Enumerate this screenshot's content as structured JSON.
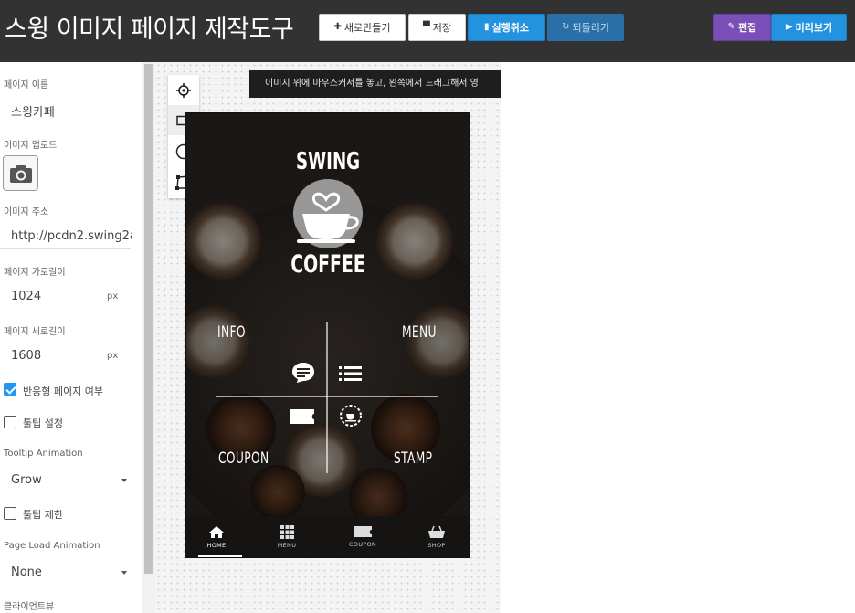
{
  "header": {
    "title": "스윙 이미지 페이지 제작도구",
    "buttons": {
      "new_label": "새로만들기",
      "save_label": "저장",
      "undo_label": "실행취소",
      "redo_label": "되돌리기",
      "edit_label": "편집",
      "preview_label": "미리보기"
    }
  },
  "sidebar": {
    "page_name_label": "페이지 이름",
    "page_name_value": "스윙카페",
    "image_upload_label": "이미지 업로드",
    "image_url_label": "이미지 주소",
    "image_url_value": "http://pcdn2.swing2a",
    "page_width_label": "페이지 가로길이",
    "page_width_value": "1024",
    "page_height_label": "페이지 세로길이",
    "page_height_value": "1608",
    "unit": "px",
    "responsive_label": "반응형 페이지 여부",
    "responsive_checked": true,
    "tooltip_setting_label": "툴팁 설정",
    "tooltip_setting_checked": false,
    "tooltip_animation_label": "Tooltip Animation",
    "tooltip_animation_value": "Grow",
    "tooltip_limit_label": "툴팁 제한",
    "tooltip_limit_checked": false,
    "page_load_animation_label": "Page Load Animation",
    "page_load_animation_value": "None",
    "client_view_label": "클라이언트뷰"
  },
  "canvas": {
    "hint_text": "이미지 위에 마우스커서를 놓고, 왼쪽에서 드래그해서 영",
    "tools": [
      "crosshair-icon",
      "rectangle-icon",
      "circle-icon",
      "polygon-icon"
    ]
  },
  "preview": {
    "brand_top": "SWING",
    "brand_bottom": "COFFEE",
    "quadrants": {
      "info": "INFO",
      "menu": "MENU",
      "coupon": "COUPON",
      "stamp": "STAMP"
    },
    "tabs": [
      {
        "label": "HOME",
        "icon": "home-icon",
        "active": true
      },
      {
        "label": "MENU",
        "icon": "grid-icon",
        "active": false
      },
      {
        "label": "COUPON",
        "icon": "ticket-icon",
        "active": false
      },
      {
        "label": "SHOP",
        "icon": "basket-icon",
        "active": false
      }
    ]
  },
  "colors": {
    "header_bg": "#323232",
    "primary_blue": "#2393e0",
    "edit_purple": "#7b4fb8",
    "checkbox_blue": "#2196f3"
  }
}
